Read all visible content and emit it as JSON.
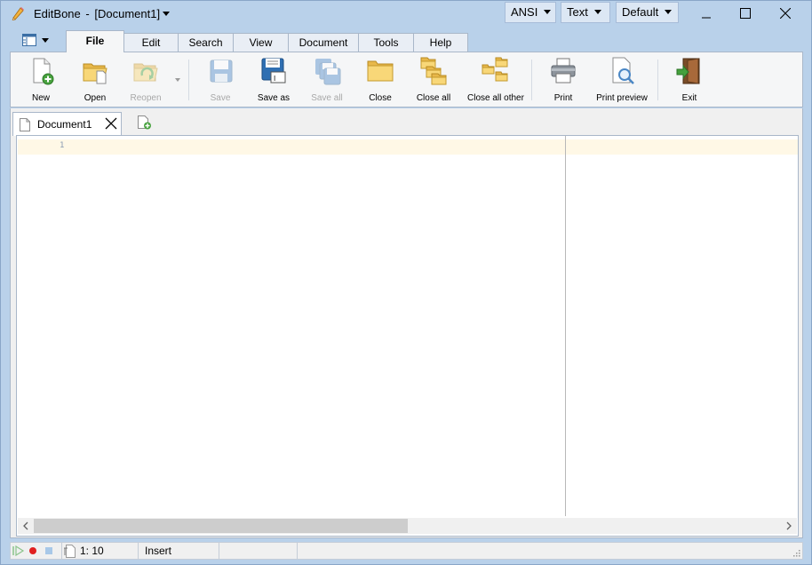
{
  "titlebar": {
    "app_name": "EditBone",
    "separator": "-",
    "document_title": "[Document1]",
    "encoding": "ANSI",
    "highlighter": "Text",
    "color_scheme": "Default"
  },
  "ribbon": {
    "tabs": [
      {
        "label": "File",
        "active": true
      },
      {
        "label": "Edit"
      },
      {
        "label": "Search"
      },
      {
        "label": "View"
      },
      {
        "label": "Document"
      },
      {
        "label": "Tools"
      },
      {
        "label": "Help"
      }
    ],
    "buttons": {
      "new": "New",
      "open": "Open",
      "reopen": "Reopen",
      "save": "Save",
      "save_as": "Save as",
      "save_all": "Save all",
      "close": "Close",
      "close_all": "Close all",
      "close_all_other": "Close all other",
      "print": "Print",
      "print_preview": "Print preview",
      "exit": "Exit"
    }
  },
  "documents": {
    "tabs": [
      {
        "label": "Document1"
      }
    ]
  },
  "editor": {
    "line_numbers": [
      "1"
    ]
  },
  "statusbar": {
    "position": "1: 10",
    "mode": "Insert"
  },
  "colors": {
    "titlebar_bg": "#b9d1ea",
    "current_line": "#fff8e6"
  }
}
